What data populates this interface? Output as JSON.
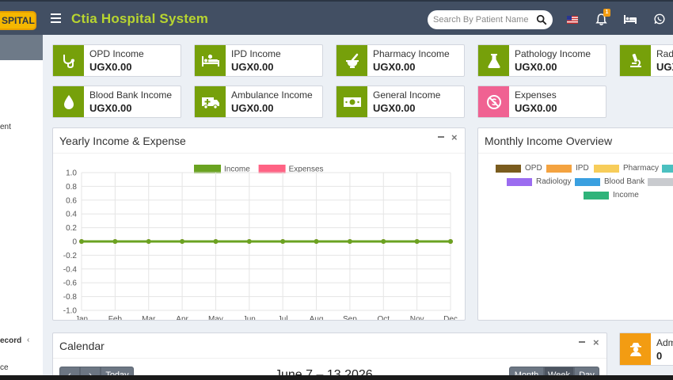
{
  "header": {
    "logo_text": "SPITAL",
    "title": "Ctia Hospital System",
    "search_placeholder": "Search By Patient Name",
    "notification_count": "1"
  },
  "sidebar": {
    "items": [
      {
        "label": "ent"
      },
      {
        "label": "ecord"
      },
      {
        "label": "ce"
      }
    ]
  },
  "income_cards": [
    {
      "label": "OPD Income",
      "value": "UGX0.00",
      "color": "#76a00a",
      "icon": "stethoscope-icon"
    },
    {
      "label": "IPD Income",
      "value": "UGX0.00",
      "color": "#76a00a",
      "icon": "ambulance-bed-icon"
    },
    {
      "label": "Pharmacy Income",
      "value": "UGX0.00",
      "color": "#76a00a",
      "icon": "mortar-pestle-icon"
    },
    {
      "label": "Pathology Income",
      "value": "UGX0.00",
      "color": "#76a00a",
      "icon": "flask-icon"
    },
    {
      "label": "Rad",
      "value": "UGX",
      "color": "#76a00a",
      "icon": "microscope-icon"
    },
    {
      "label": "Blood Bank Income",
      "value": "UGX0.00",
      "color": "#76a00a",
      "icon": "droplet-icon"
    },
    {
      "label": "Ambulance Income",
      "value": "UGX0.00",
      "color": "#76a00a",
      "icon": "ambulance-icon"
    },
    {
      "label": "General Income",
      "value": "UGX0.00",
      "color": "#76a00a",
      "icon": "money-icon"
    },
    {
      "label": "Expenses",
      "value": "UGX0.00",
      "color": "#f06292",
      "icon": "no-money-icon"
    }
  ],
  "yearly_panel": {
    "title": "Yearly Income & Expense"
  },
  "monthly_panel": {
    "title": "Monthly Income Overview",
    "legend": [
      {
        "label": "OPD",
        "color": "#7a5c1e"
      },
      {
        "label": "IPD",
        "color": "#f4a340"
      },
      {
        "label": "Pharmacy",
        "color": "#f7cd5a"
      },
      {
        "label": "Radiology",
        "color": "#9b6cf0"
      },
      {
        "label": "Blood Bank",
        "color": "#3aa0e0"
      },
      {
        "label": "Income",
        "color": "#2fb37a"
      }
    ]
  },
  "calendar_panel": {
    "title": "Calendar",
    "today_label": "Today",
    "range_label": "June 7 – 13 2026",
    "view_buttons": [
      "Month",
      "Week",
      "Day"
    ]
  },
  "admin_card": {
    "label": "Adm",
    "value": "0",
    "color": "#f39c12"
  },
  "chart_data": {
    "type": "line",
    "title": "",
    "categories": [
      "Jan",
      "Feb",
      "Mar",
      "Apr",
      "May",
      "Jun",
      "Jul",
      "Aug",
      "Sep",
      "Oct",
      "Nov",
      "Dec"
    ],
    "series": [
      {
        "name": "Income",
        "color": "#6aa321",
        "values": [
          0,
          0,
          0,
          0,
          0,
          0,
          0,
          0,
          0,
          0,
          0,
          0
        ]
      },
      {
        "name": "Expenses",
        "color": "#ff6384",
        "values": [
          0,
          0,
          0,
          0,
          0,
          0,
          0,
          0,
          0,
          0,
          0,
          0
        ]
      }
    ],
    "ylim": [
      -1.0,
      1.0
    ],
    "yticks": [
      "1.0",
      "0.8",
      "0.6",
      "0.4",
      "0.2",
      "0",
      "-0.2",
      "-0.4",
      "-0.6",
      "-0.8",
      "-1.0"
    ],
    "grid": true,
    "legend_position": "top"
  }
}
